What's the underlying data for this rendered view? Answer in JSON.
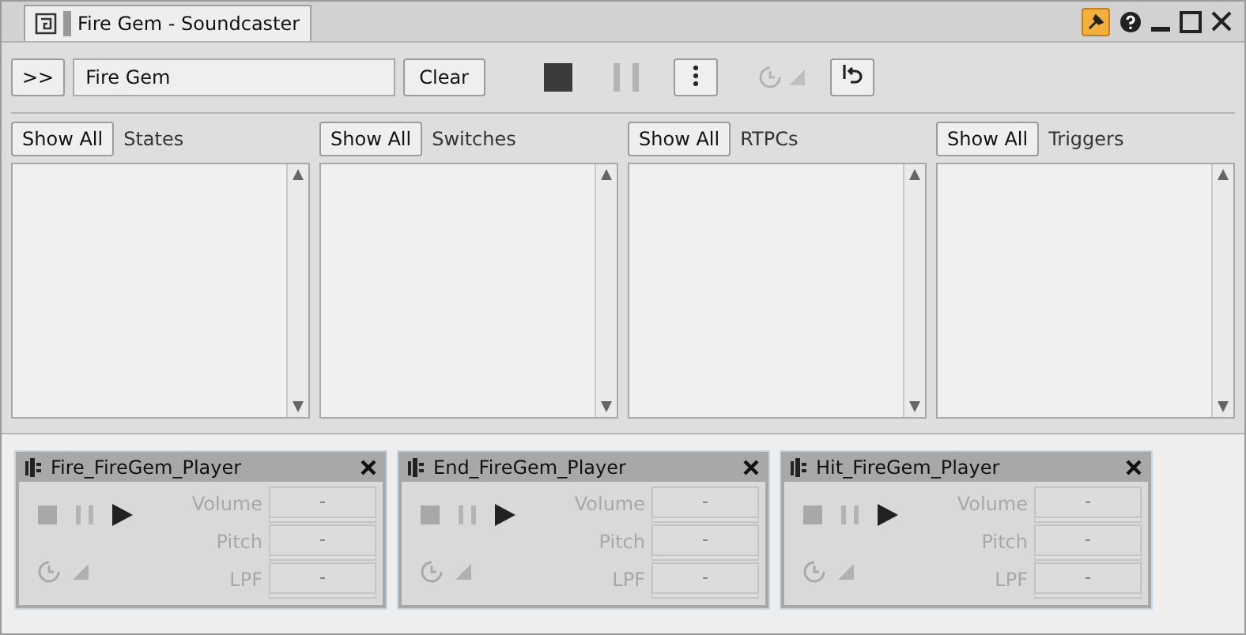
{
  "window": {
    "title": "Fire Gem - Soundcaster"
  },
  "toolbar": {
    "expand_label": ">>",
    "search_value": "Fire Gem",
    "clear_label": "Clear"
  },
  "filters": [
    {
      "button": "Show All",
      "label": "States"
    },
    {
      "button": "Show All",
      "label": "Switches"
    },
    {
      "button": "Show All",
      "label": "RTPCs"
    },
    {
      "button": "Show All",
      "label": "Triggers"
    }
  ],
  "players": [
    {
      "name": "Fire_FireGem_Player",
      "params": [
        {
          "label": "Volume",
          "value": "-"
        },
        {
          "label": "Pitch",
          "value": "-"
        },
        {
          "label": "LPF",
          "value": "-"
        }
      ]
    },
    {
      "name": "End_FireGem_Player",
      "params": [
        {
          "label": "Volume",
          "value": "-"
        },
        {
          "label": "Pitch",
          "value": "-"
        },
        {
          "label": "LPF",
          "value": "-"
        }
      ]
    },
    {
      "name": "Hit_FireGem_Player",
      "params": [
        {
          "label": "Volume",
          "value": "-"
        },
        {
          "label": "Pitch",
          "value": "-"
        },
        {
          "label": "LPF",
          "value": "-"
        }
      ]
    }
  ]
}
